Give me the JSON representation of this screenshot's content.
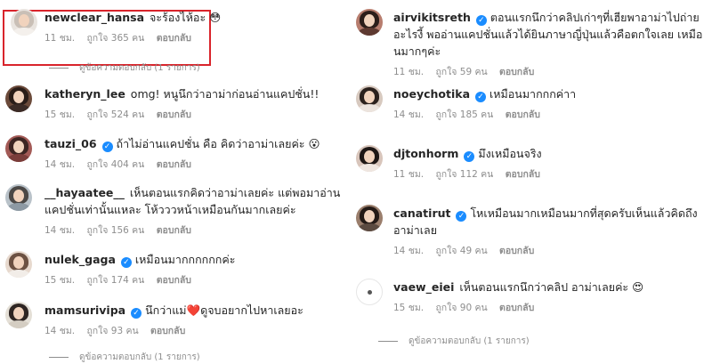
{
  "left": {
    "comments": [
      {
        "username": "newclear_hansa",
        "verified": false,
        "text": "จะร้องไห้อะ 😳",
        "time": "11 ชม.",
        "likes": "ถูกใจ 365 คน",
        "reply": "ตอบกลับ",
        "highlighted": true
      },
      {
        "username": "katheryn_lee",
        "verified": false,
        "text": "omg! หนูนึกว่าอาม่าก่อนอ่านแคปชั่น!!",
        "time": "15 ชม.",
        "likes": "ถูกใจ 524 คน",
        "reply": "ตอบกลับ"
      },
      {
        "username": "tauzi_06",
        "verified": true,
        "text": "ถ้าไม่อ่านแคปชั่น คือ คิดว่าอาม่าเลยค่ะ 😮",
        "time": "14 ชม.",
        "likes": "ถูกใจ 404 คน",
        "reply": "ตอบกลับ"
      },
      {
        "username": "__hayaatee__",
        "verified": false,
        "text": "เห็นตอนแรกคิดว่าอาม่าเลยค่ะ แต่พอมาอ่านแคปชั่นเท่านั้นแหละ โห้วววหน้าเหมือนกันมากเลยค่ะ",
        "time": "14 ชม.",
        "likes": "ถูกใจ 156 คน",
        "reply": "ตอบกลับ"
      },
      {
        "username": "nulek_gaga",
        "verified": true,
        "text": "เหมือนมากกกกกกค่ะ",
        "time": "15 ชม.",
        "likes": "ถูกใจ 174 คน",
        "reply": "ตอบกลับ"
      },
      {
        "username": "mamsurivipa",
        "verified": true,
        "text": "นึกว่าแม่❤️ดูจบอยากไปหาเลยอะ",
        "time": "14 ชม.",
        "likes": "ถูกใจ 93 คน",
        "reply": "ตอบกลับ"
      }
    ],
    "view_replies_1": "ดูข้อความตอบกลับ (1 รายการ)",
    "view_replies_2": "ดูข้อความตอบกลับ (1 รายการ)"
  },
  "right": {
    "comments": [
      {
        "username": "airvikitsreth",
        "verified": true,
        "text": "ตอนแรกนึกว่าคลิปเก่าๆที่เฮียพาอาม่าไปถ่ายอะไรงี้ พออ่านแคปชั่นแล้วได้ยินภาษาญี่ปุ่นแล้วคือตกใจเลย เหมือนมากๆค่ะ",
        "time": "11 ชม.",
        "likes": "ถูกใจ 59 คน",
        "reply": "ตอบกลับ"
      },
      {
        "username": "noeychotika",
        "verified": true,
        "text": "เหมือนมากกกค่าา",
        "time": "14 ชม.",
        "likes": "ถูกใจ 185 คน",
        "reply": "ตอบกลับ"
      },
      {
        "username": "djtonhorm",
        "verified": true,
        "text": "มึงเหมือนจริง",
        "time": "11 ชม.",
        "likes": "ถูกใจ 112 คน",
        "reply": "ตอบกลับ"
      },
      {
        "username": "canatirut",
        "verified": true,
        "text": "โหเหมือนมากเหมือนมากที่สุดครับเห็นแล้วคิดถึงอาม่าเลย",
        "time": "14 ชม.",
        "likes": "ถูกใจ 49 คน",
        "reply": "ตอบกลับ"
      },
      {
        "username": "vaew_eiei",
        "verified": false,
        "text": "เห็นตอนแรกนึกว่าคลิป อาม่าเลยค่ะ 😍",
        "time": "15 ชม.",
        "likes": "ถูกใจ 90 คน",
        "reply": "ตอบกลับ"
      }
    ],
    "view_replies": "ดูข้อความตอบกลับ (1 รายการ)"
  },
  "colors": {
    "verified": "#1a8cff",
    "highlight_border": "#d9242b",
    "meta": "#8e8e8e",
    "text": "#262626"
  }
}
